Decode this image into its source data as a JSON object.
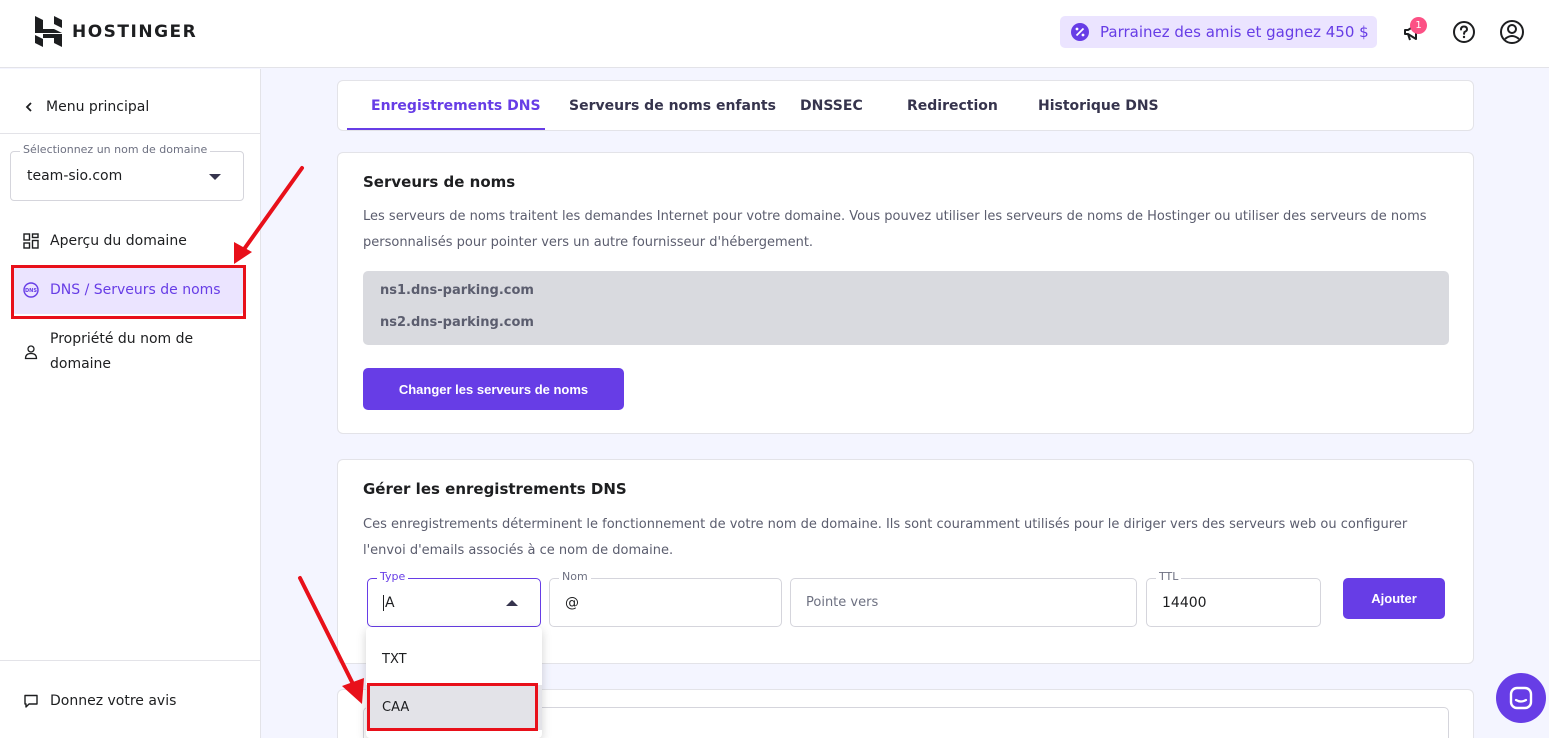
{
  "header": {
    "logo_text": "HOSTINGER",
    "referral_label": "Parrainez des amis et gagnez 450 $",
    "notification_count": "1"
  },
  "sidebar": {
    "back_label": "Menu principal",
    "domain_select": {
      "legend": "Sélectionnez un nom de domaine",
      "value": "team-sio.com"
    },
    "items": [
      {
        "label": "Aperçu du domaine",
        "icon": "grid-icon"
      },
      {
        "label": "DNS / Serveurs de noms",
        "icon": "dns-icon",
        "active": true
      },
      {
        "label": "Propriété du nom de domaine",
        "icon": "user-icon"
      }
    ],
    "feedback_label": "Donnez votre avis"
  },
  "tabs": [
    {
      "label": "Enregistrements DNS",
      "active": true
    },
    {
      "label": "Serveurs de noms enfants"
    },
    {
      "label": "DNSSEC"
    },
    {
      "label": "Redirection"
    },
    {
      "label": "Historique DNS"
    }
  ],
  "nameservers": {
    "title": "Serveurs de noms",
    "description": "Les serveurs de noms traitent les demandes Internet pour votre domaine. Vous pouvez utiliser les serveurs de noms de Hostinger ou utiliser des serveurs de noms personnalisés pour pointer vers un autre fournisseur d'hébergement.",
    "servers": [
      "ns1.dns-parking.com",
      "ns2.dns-parking.com"
    ],
    "change_button": "Changer les serveurs de noms"
  },
  "dns_records": {
    "title": "Gérer les enregistrements DNS",
    "description": "Ces enregistrements déterminent le fonctionnement de votre nom de domaine. Ils sont couramment utilisés pour le diriger vers des serveurs web ou configurer l'envoi d'emails associés à ce nom de domaine.",
    "type": {
      "legend": "Type",
      "value": "A"
    },
    "name": {
      "legend": "Nom",
      "value": "@"
    },
    "points_to": {
      "placeholder": "Pointe vers"
    },
    "ttl": {
      "legend": "TTL",
      "value": "14400"
    },
    "add_button": "Ajouter",
    "type_options": [
      "TXT",
      "CAA"
    ]
  },
  "colors": {
    "accent": "#673de6",
    "annotation_red": "#e8101a",
    "accent_light": "#ebe4ff"
  }
}
